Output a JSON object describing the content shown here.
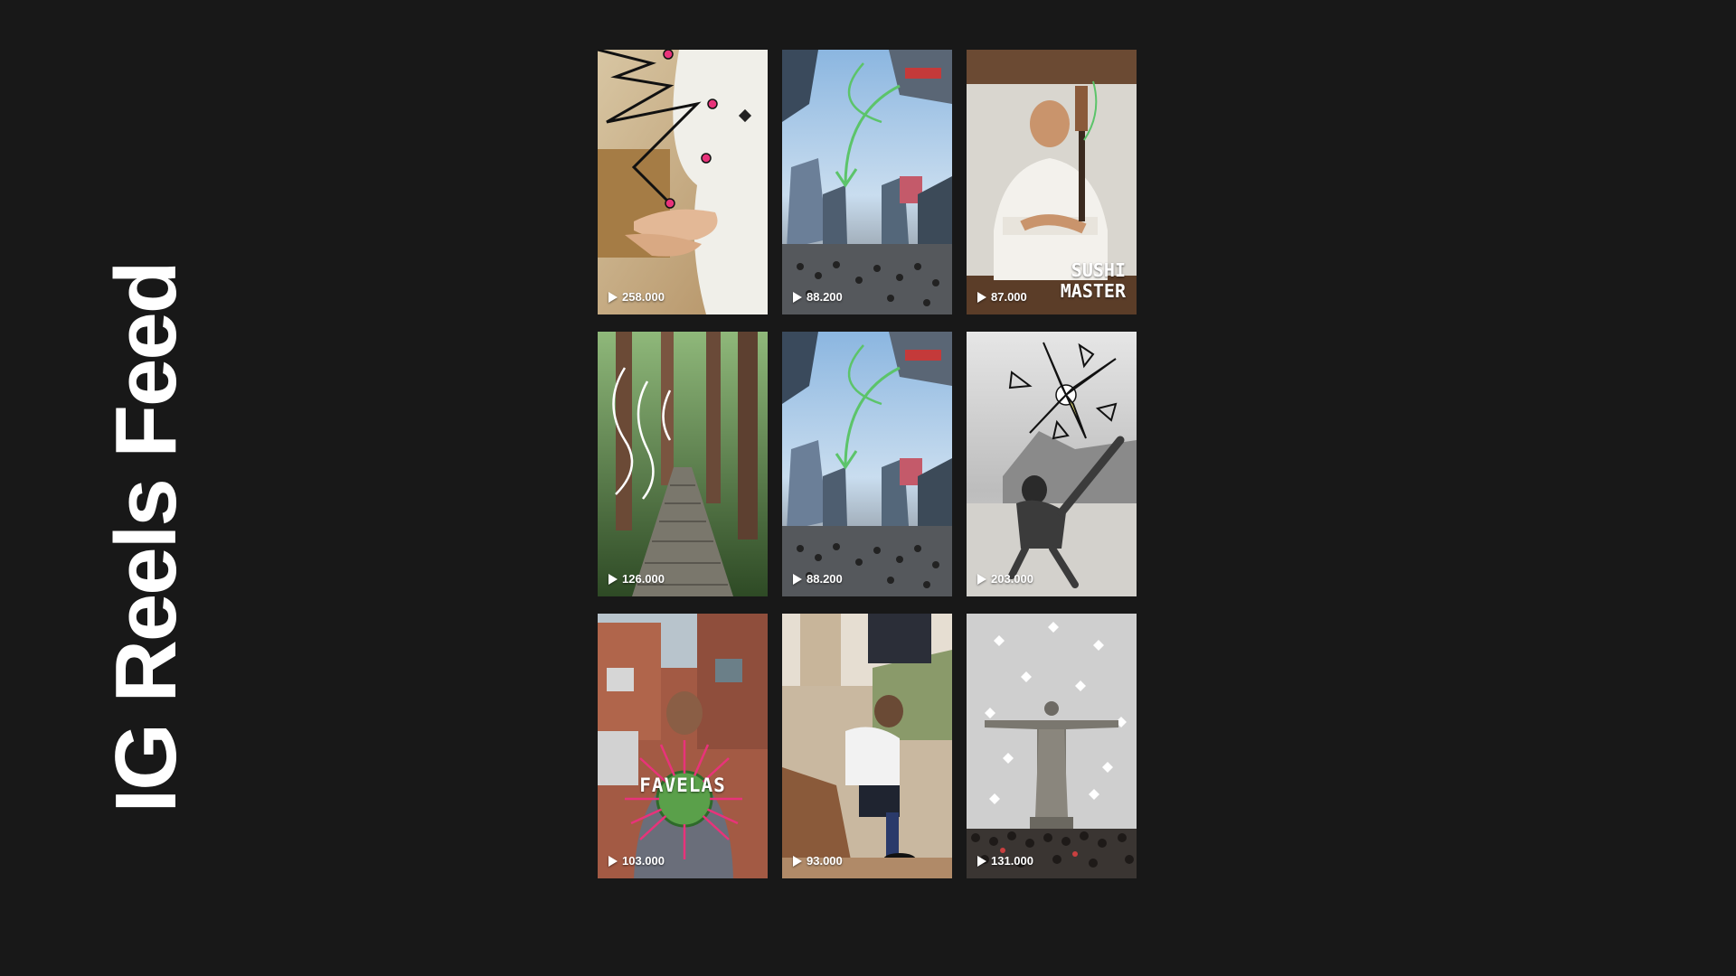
{
  "page": {
    "title": "IG Reels Feed",
    "background": "#181818"
  },
  "reels": [
    {
      "views": "258.000",
      "scene": "chef hands with black doodle lines",
      "play_icon": "play-icon"
    },
    {
      "views": "88.200",
      "scene": "city crossing with green arrow doodle",
      "play_icon": "play-icon"
    },
    {
      "views": "87.000",
      "scene": "sushi master holding knife",
      "overlay": "SUSHI\nMASTER",
      "play_icon": "play-icon"
    },
    {
      "views": "126.000",
      "scene": "forest stairway with white wind doodle",
      "play_icon": "play-icon"
    },
    {
      "views": "88.200",
      "scene": "city crossing with green arrow doodle",
      "play_icon": "play-icon"
    },
    {
      "views": "203.000",
      "scene": "beach bicycle kick with yellow star doodle",
      "play_icon": "play-icon"
    },
    {
      "views": "103.000",
      "scene": "favela boy holding globe",
      "overlay": "FAVELAS",
      "play_icon": "play-icon"
    },
    {
      "views": "93.000",
      "scene": "football player tying boots",
      "play_icon": "play-icon"
    },
    {
      "views": "131.000",
      "scene": "christ the redeemer with crowd",
      "play_icon": "play-icon"
    }
  ],
  "colors": {
    "doodle_green": "#5cc46a",
    "doodle_pink": "#e8337a",
    "doodle_yellow": "#f2ea7a"
  }
}
